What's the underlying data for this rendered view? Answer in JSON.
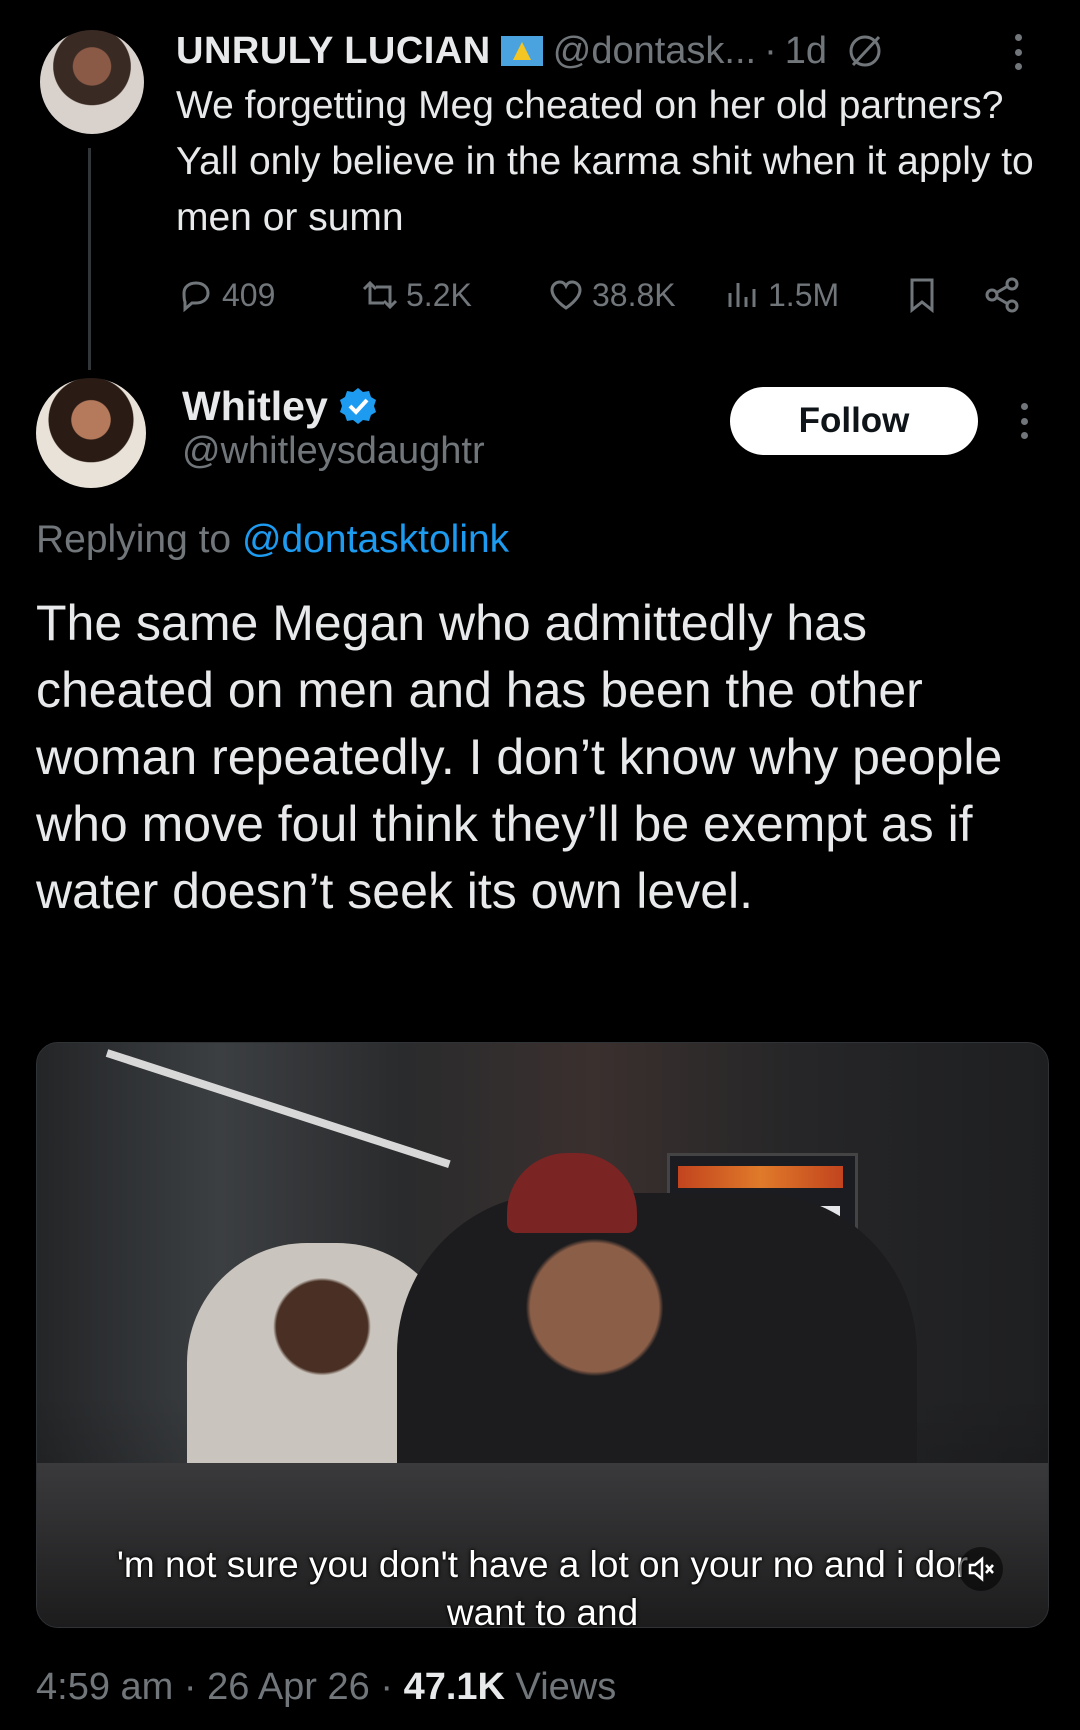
{
  "parent_tweet": {
    "display_name": "UNRULY LUCIAN",
    "flag_icon": "saint-lucia-flag-icon",
    "handle": "@dontask...",
    "separator": "·",
    "time": "1d",
    "text": "We forgetting Meg cheated on her old partners? Yall only believe in the karma shit when it apply to men or sumn",
    "replies": "409",
    "reposts": "5.2K",
    "likes": "38.8K",
    "views": "1.5M"
  },
  "main_tweet": {
    "display_name": "Whitley",
    "handle": "@whitleysdaughtr",
    "follow_label": "Follow",
    "replying_prefix": "Replying to ",
    "replying_mention": "@dontasktolink",
    "text": "The same Megan who admittedly has cheated on men and has been the other woman repeatedly. I don’t know why people who move foul think they’ll be exempt as if water doesn’t seek its own level.",
    "media": {
      "caption_line1": "'m not sure you don't have a lot on your no and i dor",
      "caption_line2": "want to and",
      "muted": true
    },
    "time": "4:59 am",
    "date": "26 Apr 26",
    "views_count": "47.1K",
    "views_label": "Views",
    "meta_separator": "·"
  },
  "colors": {
    "background": "#000000",
    "text_primary": "#e7e9ea",
    "text_secondary": "#71767b",
    "link": "#1d9bf0",
    "verified": "#1d9bf0"
  }
}
